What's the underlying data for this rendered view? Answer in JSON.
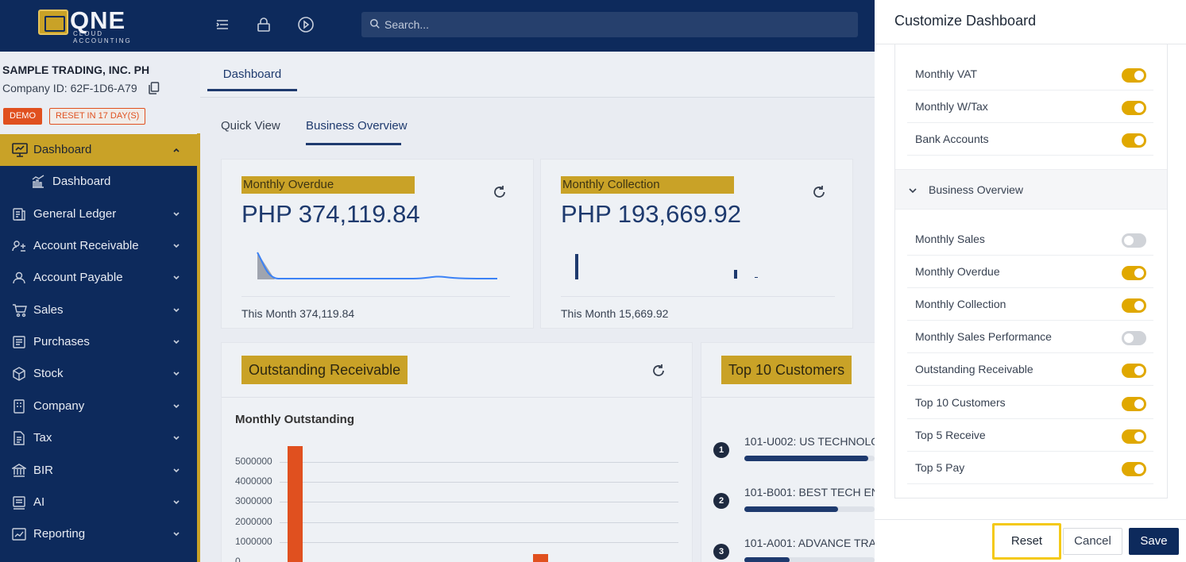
{
  "app": {
    "logo_text": "QNE",
    "logo_subtext": "CLOUD ACCOUNTING",
    "search_placeholder": "Search..."
  },
  "company": {
    "name": "SAMPLE TRADING, INC. PH",
    "id_text": "Company ID: 62F-1D6-A79",
    "badge_demo": "DEMO",
    "badge_reset": "RESET IN 17 DAY(S)"
  },
  "sidebar": {
    "items": [
      {
        "label": "Dashboard",
        "icon": "monitor-icon"
      },
      {
        "label": "Dashboard",
        "icon": "chart-icon"
      },
      {
        "label": "General Ledger",
        "icon": "ledger-icon"
      },
      {
        "label": "Account Receivable",
        "icon": "receivable-icon"
      },
      {
        "label": "Account Payable",
        "icon": "user-icon"
      },
      {
        "label": "Sales",
        "icon": "cart-icon"
      },
      {
        "label": "Purchases",
        "icon": "purchase-icon"
      },
      {
        "label": "Stock",
        "icon": "box-icon"
      },
      {
        "label": "Company",
        "icon": "building-icon"
      },
      {
        "label": "Tax",
        "icon": "document-icon"
      },
      {
        "label": "BIR",
        "icon": "bir-icon"
      },
      {
        "label": "AI",
        "icon": "ai-icon"
      },
      {
        "label": "Reporting",
        "icon": "report-icon"
      }
    ]
  },
  "main": {
    "tab": "Dashboard",
    "subtabs": [
      "Quick View",
      "Business Overview"
    ],
    "cards": [
      {
        "label": "Monthly Overdue",
        "value": "PHP 374,119.84",
        "footer": "This Month 374,119.84"
      },
      {
        "label": "Monthly Collection",
        "value": "PHP 193,669.92",
        "footer": "This Month 15,669.92"
      }
    ],
    "outstanding": {
      "label": "Outstanding Receivable",
      "chart_title": "Monthly Outstanding"
    },
    "top_customers": {
      "label": "Top 10 Customers",
      "items": [
        {
          "rank": "1",
          "name": "101-U002: US TECHNOLO",
          "fraction": 0.95
        },
        {
          "rank": "2",
          "name": "101-B001: BEST TECH EN",
          "fraction": 0.72
        },
        {
          "rank": "3",
          "name": "101-A001: ADVANCE TRA",
          "fraction": 0.35
        }
      ]
    }
  },
  "chart_data": {
    "type": "bar",
    "title": "Monthly Outstanding",
    "yticks": [
      "5000000",
      "4000000",
      "3000000",
      "2000000",
      "1000000",
      "0"
    ],
    "ylim": [
      0,
      5000000
    ],
    "values": [
      5800000,
      400000
    ],
    "colors": {
      "bar": "#e0501f"
    }
  },
  "panel": {
    "title": "Customize Dashboard",
    "quick_view_rows": [
      {
        "label": "Monthly VAT",
        "on": true
      },
      {
        "label": "Monthly W/Tax",
        "on": true
      },
      {
        "label": "Bank Accounts",
        "on": true
      }
    ],
    "group_label": "Business Overview",
    "business_rows": [
      {
        "label": "Monthly Sales",
        "on": false
      },
      {
        "label": "Monthly Overdue",
        "on": true
      },
      {
        "label": "Monthly Collection",
        "on": true
      },
      {
        "label": "Monthly Sales Performance",
        "on": false
      },
      {
        "label": "Outstanding Receivable",
        "on": true
      },
      {
        "label": "Top 10 Customers",
        "on": true
      },
      {
        "label": "Top 5 Receive",
        "on": true
      },
      {
        "label": "Top 5 Pay",
        "on": true
      }
    ],
    "buttons": {
      "reset": "Reset",
      "cancel": "Cancel",
      "save": "Save"
    }
  },
  "colors": {
    "navy": "#0d2a5c",
    "gold": "#c9a227",
    "toggle_on": "#e0a800",
    "accent_orange": "#e0501f"
  }
}
